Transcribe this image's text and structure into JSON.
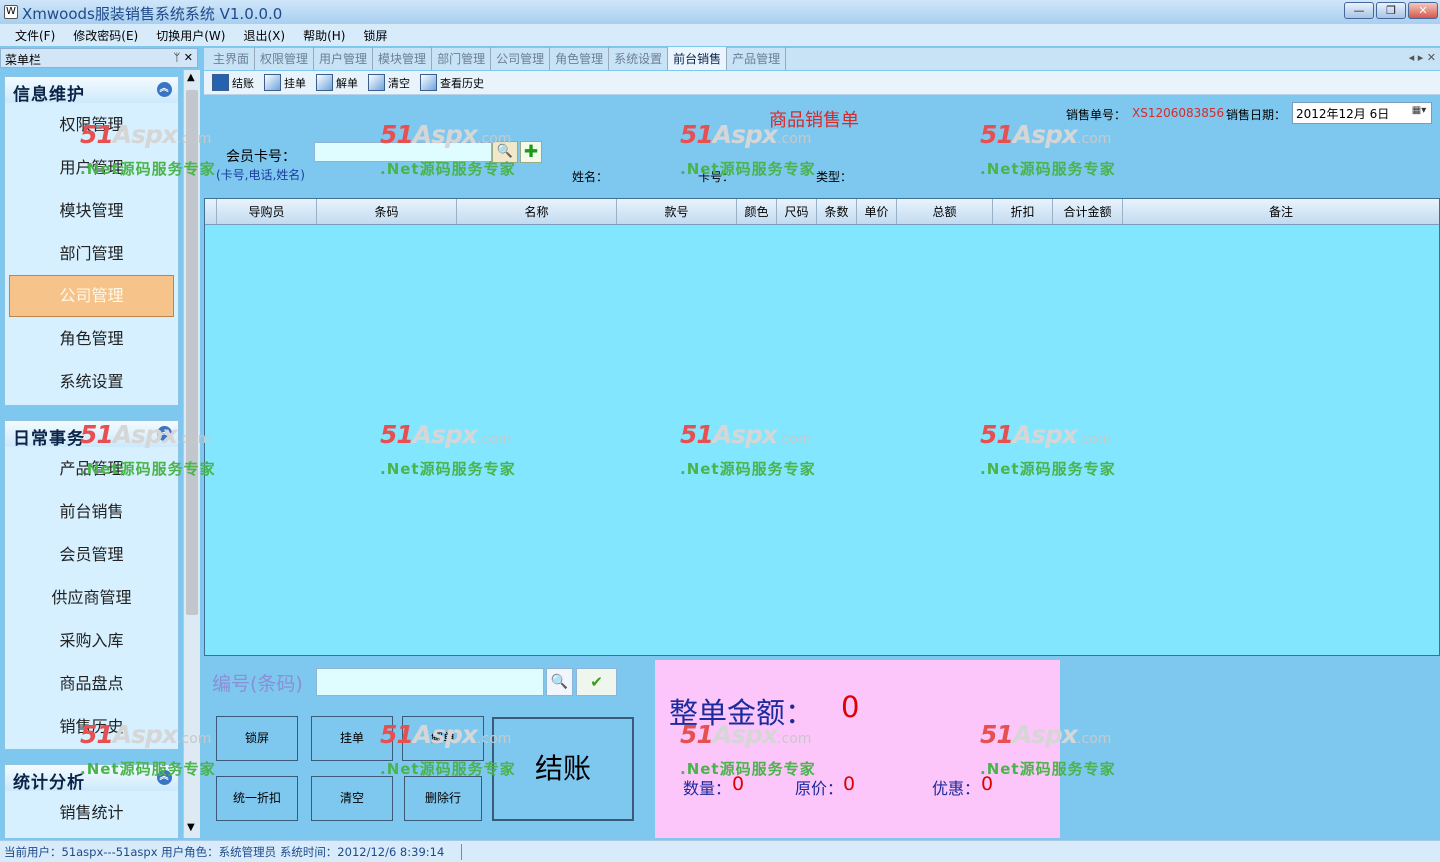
{
  "window": {
    "title": "Xmwoods服装销售系统系统 V1.0.0.0",
    "icon_name": "app-logo-icon",
    "buttons": {
      "minimize": "—",
      "restore": "❐",
      "close": "✕"
    }
  },
  "menubar": [
    {
      "label": "文件(F)"
    },
    {
      "label": "修改密码(E)"
    },
    {
      "label": "切换用户(W)"
    },
    {
      "label": "退出(X)"
    },
    {
      "label": "帮助(H)"
    },
    {
      "label": "锁屏"
    }
  ],
  "sidebar": {
    "title": "菜单栏",
    "pin_icon": "pin-icon",
    "close_icon": "close-icon",
    "groups": [
      {
        "title": "信息维护",
        "items": [
          "权限管理",
          "用户管理",
          "模块管理",
          "部门管理",
          "公司管理",
          "角色管理",
          "系统设置"
        ],
        "active_index": 4
      },
      {
        "title": "日常事务",
        "items": [
          "产品管理",
          "前台销售",
          "会员管理",
          "供应商管理",
          "采购入库",
          "商品盘点",
          "销售历史"
        ]
      },
      {
        "title": "统计分析",
        "items": [
          "销售统计"
        ]
      }
    ]
  },
  "tabs": [
    {
      "label": "主界面"
    },
    {
      "label": "权限管理"
    },
    {
      "label": "用户管理"
    },
    {
      "label": "模块管理"
    },
    {
      "label": "部门管理"
    },
    {
      "label": "公司管理"
    },
    {
      "label": "角色管理"
    },
    {
      "label": "系统设置"
    },
    {
      "label": "前台销售",
      "active": true
    },
    {
      "label": "产品管理"
    }
  ],
  "toolbar": [
    {
      "label": "结账",
      "icon": "checkout-icon"
    },
    {
      "label": "挂单",
      "icon": "hold-order-icon"
    },
    {
      "label": "解单",
      "icon": "release-order-icon"
    },
    {
      "label": "清空",
      "icon": "clear-icon"
    },
    {
      "label": "查看历史",
      "icon": "history-icon"
    }
  ],
  "form": {
    "title": "商品销售单",
    "sales_no_label": "销售单号：",
    "sales_no": "XS1206083856",
    "sales_date_label": "销售日期：",
    "sales_date": "2012年12月  6日",
    "member_card_label": "会员卡号：",
    "member_card_hint": "(卡号,电话,姓名)",
    "member_card_value": "",
    "name_label": "姓名：",
    "card_label": "卡号：",
    "type_label": "类型："
  },
  "grid": {
    "columns": [
      "导购员",
      "条码",
      "名称",
      "款号",
      "颜色",
      "尺码",
      "条数",
      "单价",
      "总额",
      "折扣",
      "合计金额",
      "备注"
    ],
    "rows": []
  },
  "entry": {
    "code_label": "编号(条码)",
    "code_value": "",
    "buttons": {
      "lock": "锁屏",
      "hold": "挂单",
      "release": "解单",
      "discount_all": "统一折扣",
      "clear": "清空",
      "delete_row": "删除行",
      "checkout": "结账"
    }
  },
  "totals": {
    "total_label": "整单金额：",
    "total_value": "0",
    "qty_label": "数量：",
    "qty_value": "0",
    "orig_label": "原价：",
    "orig_value": "0",
    "discount_label": "优惠：",
    "discount_value": "0"
  },
  "status": {
    "text": "当前用户：51aspx---51aspx  用户角色：系统管理员  系统时间：2012/12/6 8:39:14"
  },
  "watermark": {
    "logo_prefix": "51",
    "logo_main": "Aspx",
    "logo_suffix": ".com",
    "subtitle": ".Net源码服务专家"
  }
}
